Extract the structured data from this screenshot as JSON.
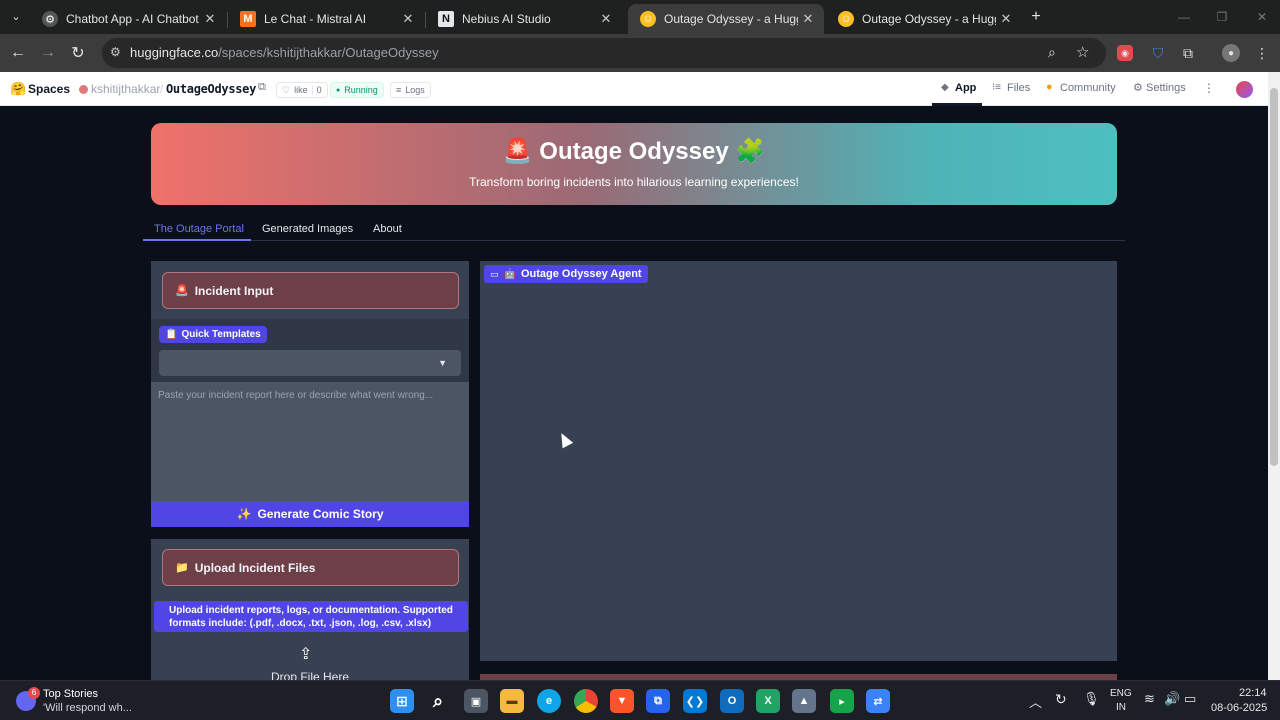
{
  "browser": {
    "tabs": [
      {
        "label": "Chatbot App - AI Chatbot",
        "active": false
      },
      {
        "label": "Le Chat - Mistral AI",
        "active": false
      },
      {
        "label": "Nebius AI Studio",
        "active": false
      },
      {
        "label": "Outage Odyssey - a Hugging Fa",
        "active": true
      },
      {
        "label": "Outage Odyssey - a Hugging Fa",
        "active": false
      }
    ],
    "new_tab": "+",
    "url_host": "huggingface.co",
    "url_path": "/spaces/kshitijthakkar/OutageOdyssey"
  },
  "hf_header": {
    "spaces_label": "Spaces",
    "owner": "kshitijthakkar",
    "separator": "/",
    "repo": "OutageOdyssey",
    "like_label": "like",
    "like_count": "0",
    "status": "Running",
    "logs_label": "Logs",
    "nav": {
      "app": "App",
      "files": "Files",
      "community": "Community",
      "settings": "Settings"
    }
  },
  "banner": {
    "icon_left": "🚨",
    "title": "Outage Odyssey",
    "icon_right": "🧩",
    "subtitle": "Transform boring incidents into hilarious learning experiences!"
  },
  "app_tabs": [
    "The Outage Portal",
    "Generated Images",
    "About"
  ],
  "incident_section": {
    "icon": "🚨",
    "header": "Incident Input",
    "templates_icon": "📋",
    "templates_label": "Quick Templates",
    "dropdown_value": "",
    "textarea_placeholder": "Paste your incident report here or describe what went wrong...",
    "generate_icon": "✨",
    "generate_label": "Generate Comic Story"
  },
  "upload_section": {
    "icon": "📁",
    "header": "Upload Incident Files",
    "info_text": "Upload incident reports, logs, or documentation. Supported formats include: (.pdf, .docx, .txt, .json, .log, .csv, .xlsx)",
    "drop_icon": "⇪",
    "drop_text": "Drop File Here"
  },
  "agent_panel": {
    "icon": "🤖",
    "label": "Outage Odyssey Agent"
  },
  "taskbar": {
    "news_badge": "6",
    "news_title": "Top Stories",
    "news_subtitle": "'Will respond wh...",
    "lang_top": "ENG",
    "lang_bottom": "IN",
    "time": "22:14",
    "date": "08-06-2025"
  },
  "colors": {
    "accent": "#4f46e5",
    "section_header": "#6d3f49",
    "banner_start": "#f0716a",
    "banner_end": "#4dbfbf",
    "running_green": "#10b981"
  }
}
